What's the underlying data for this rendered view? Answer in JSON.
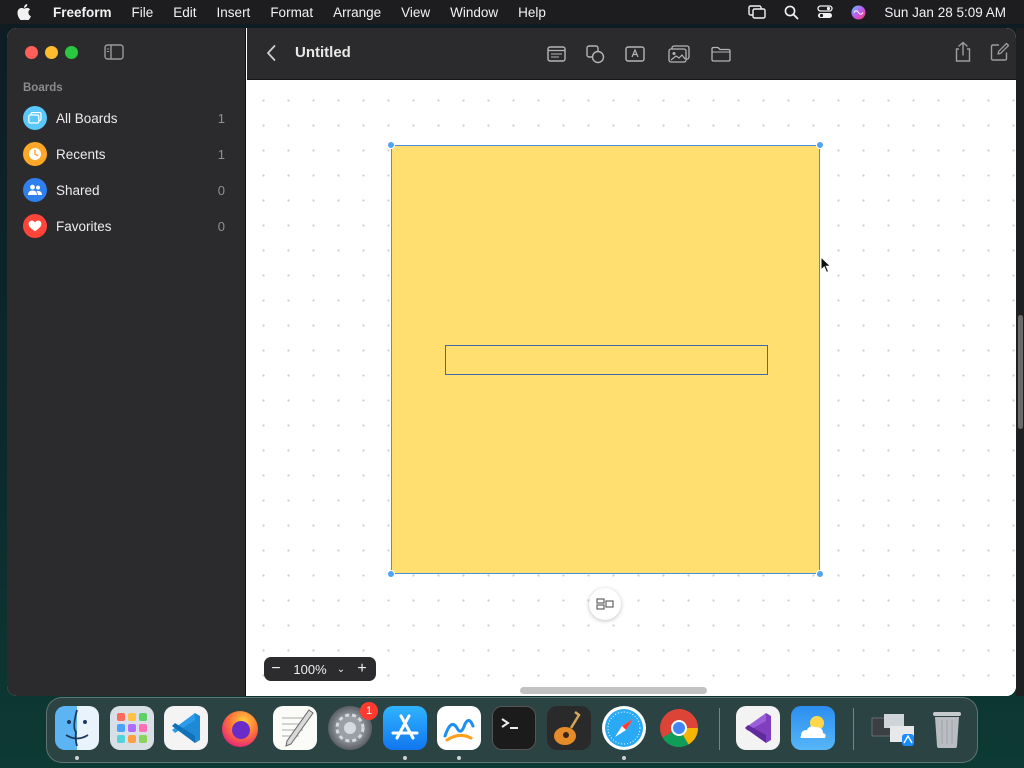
{
  "menubar": {
    "app_name": "Freeform",
    "items": [
      "File",
      "Edit",
      "Insert",
      "Format",
      "Arrange",
      "View",
      "Window",
      "Help"
    ],
    "clock": "Sun Jan 28  5:09 AM"
  },
  "sidebar": {
    "heading": "Boards",
    "items": [
      {
        "label": "All Boards",
        "count": "1",
        "color": "#5ac8fa"
      },
      {
        "label": "Recents",
        "count": "1",
        "color": "#ffa726"
      },
      {
        "label": "Shared",
        "count": "0",
        "color": "#2f80ed"
      },
      {
        "label": "Favorites",
        "count": "0",
        "color": "#ff453a"
      }
    ]
  },
  "toolbar": {
    "title": "Untitled"
  },
  "canvas": {
    "note_color": "#fedf6f",
    "selection_color": "#4a90d9"
  },
  "zoom": {
    "out": "−",
    "level": "100%",
    "menu": "⌄",
    "in": "+"
  },
  "dock": {
    "settings_badge": "1",
    "apps": [
      "finder",
      "launchpad",
      "vscode",
      "firefox",
      "textedit",
      "system-settings",
      "app-store",
      "freeform",
      "terminal",
      "garageband",
      "safari",
      "chrome",
      "visual-studio",
      "weather",
      "downloads",
      "trash"
    ]
  }
}
